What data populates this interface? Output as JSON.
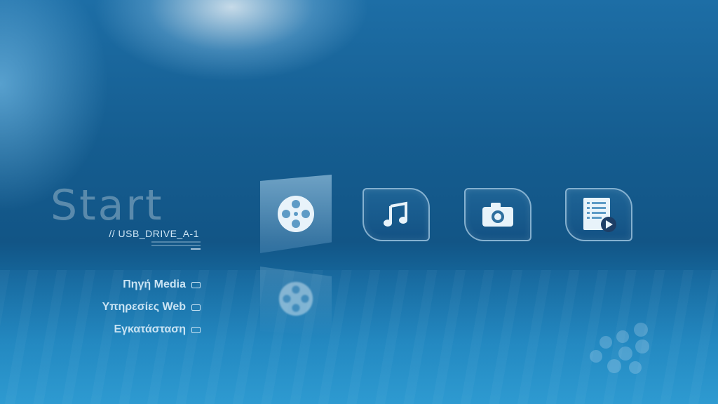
{
  "header": {
    "title": "Start",
    "source": "// USB_DRIVE_A-1"
  },
  "menu": [
    {
      "label": "Πηγή Media"
    },
    {
      "label": "Υπηρεσίες Web"
    },
    {
      "label": "Εγκατάσταση"
    }
  ],
  "tiles": [
    {
      "icon": "film-reel-icon",
      "selected": true
    },
    {
      "icon": "music-note-icon",
      "selected": false
    },
    {
      "icon": "camera-icon",
      "selected": false
    },
    {
      "icon": "playlist-icon",
      "selected": false
    }
  ],
  "colors": {
    "background": "#155d90",
    "text": "#c9e3f3",
    "tile_border": "#aacde6"
  }
}
